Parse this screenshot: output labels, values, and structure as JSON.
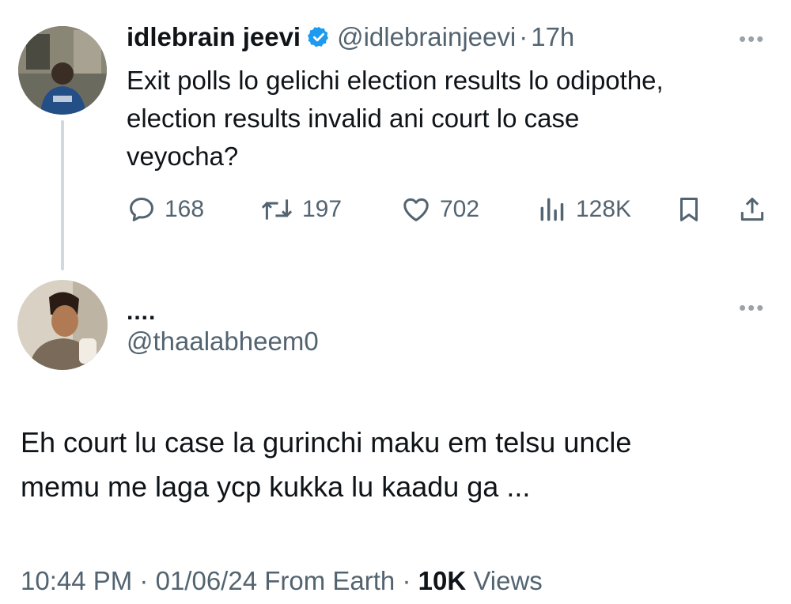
{
  "original_tweet": {
    "display_name": "idlebrain jeevi",
    "handle": "@idlebrainjeevi",
    "separator": "·",
    "time_ago": "17h",
    "text_lines": [
      "Exit polls lo gelichi election results lo odipothe,",
      "election results invalid ani court lo case",
      "veyocha?"
    ],
    "metrics": {
      "replies": "168",
      "retweets": "197",
      "likes": "702",
      "views": "128K"
    }
  },
  "reply": {
    "display_name": "....",
    "handle": "@thaalabheem0",
    "text_lines": [
      "Eh court lu case la gurinchi maku em telsu uncle",
      "memu me laga ycp kukka lu kaadu ga ..."
    ],
    "time": "10:44 PM",
    "date": "01/06/24",
    "source": "From Earth",
    "views_count": "10K",
    "views_label": "Views"
  },
  "colors": {
    "verified": "#1d9bf0",
    "muted": "#536471",
    "text": "#0f1419",
    "thread_line": "#cfd9de"
  },
  "icons": [
    "verified-badge-icon",
    "more-icon",
    "reply-icon",
    "retweet-icon",
    "like-icon",
    "views-icon",
    "bookmark-icon",
    "share-icon"
  ]
}
